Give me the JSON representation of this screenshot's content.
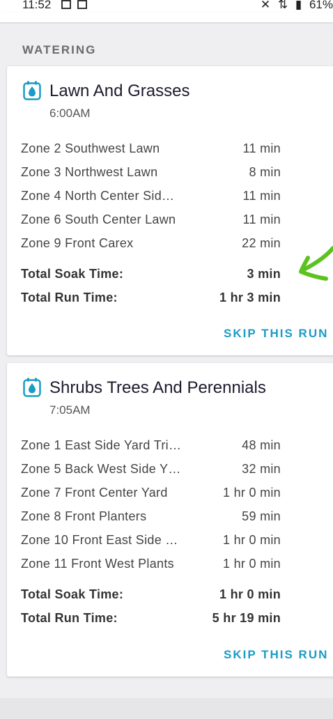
{
  "status_bar": {
    "time": "11:52",
    "battery": "61%",
    "icons": [
      "notes-icon",
      "image-icon",
      "mute-icon",
      "data-icon",
      "signal-icon"
    ]
  },
  "section": {
    "title": "WATERING"
  },
  "programs": [
    {
      "name": "Lawn And Grasses",
      "start_time": "6:00AM",
      "zones": [
        {
          "name": "Zone 2 Southwest Lawn",
          "duration": "11 min"
        },
        {
          "name": "Zone 3 Northwest Lawn",
          "duration": "8 min"
        },
        {
          "name": "Zone 4 North Center Sid…",
          "duration": "11 min"
        },
        {
          "name": "Zone 6 South Center Lawn",
          "duration": "11 min"
        },
        {
          "name": "Zone 9 Front Carex",
          "duration": "22 min"
        }
      ],
      "soak_label": "Total Soak Time:",
      "soak_value": "3 min",
      "run_label": "Total Run Time:",
      "run_value": "1 hr 3 min",
      "skip_label": "SKIP THIS RUN"
    },
    {
      "name": "Shrubs Trees And Perennials",
      "start_time": "7:05AM",
      "zones": [
        {
          "name": "Zone 1 East Side Yard Tri…",
          "duration": "48 min"
        },
        {
          "name": "Zone 5 Back West Side Y…",
          "duration": "32 min"
        },
        {
          "name": "Zone 7 Front Center Yard",
          "duration": "1 hr 0 min"
        },
        {
          "name": "Zone 8 Front Planters",
          "duration": "59 min"
        },
        {
          "name": "Zone 10 Front East Side …",
          "duration": "1 hr 0 min"
        },
        {
          "name": "Zone 11 Front West Plants",
          "duration": "1 hr 0 min"
        }
      ],
      "soak_label": "Total Soak Time:",
      "soak_value": "1 hr 0 min",
      "run_label": "Total Run Time:",
      "run_value": "5 hr 19 min",
      "skip_label": "SKIP THIS RUN"
    }
  ],
  "colors": {
    "accent": "#1b9bc6",
    "annotation_arrow": "#5cc21f"
  }
}
